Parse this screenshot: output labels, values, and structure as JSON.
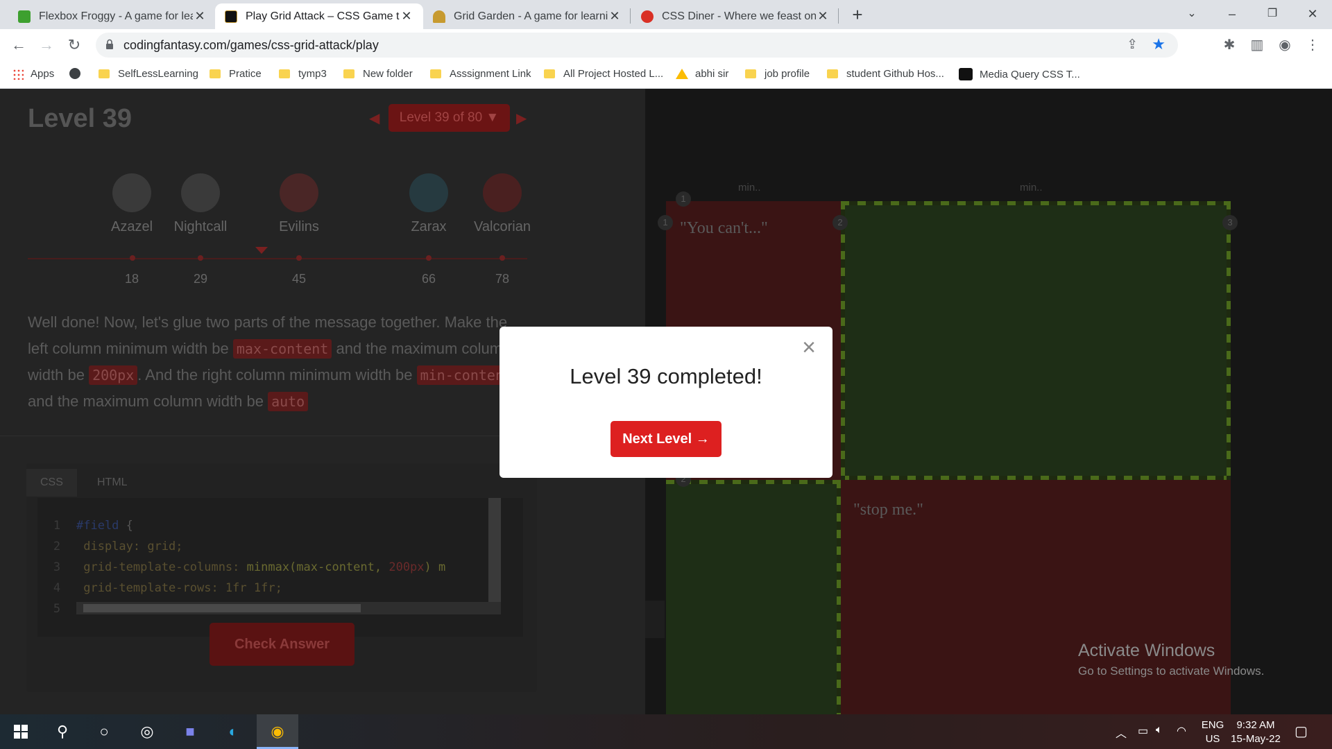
{
  "browser": {
    "tabs": [
      {
        "title": "Flexbox Froggy - A game for lear",
        "favicon_color": "#3da02f"
      },
      {
        "title": "Play Grid Attack – CSS Game to l",
        "favicon_color": "#111111"
      },
      {
        "title": "Grid Garden - A game for learnin",
        "favicon_color": "#c79a2f"
      },
      {
        "title": "CSS Diner - Where we feast on C",
        "favicon_color": "#d93025"
      }
    ],
    "url": "codingfantasy.com/games/css-grid-attack/play",
    "bookmarks": [
      {
        "label": "Apps",
        "icon": "apps-grid-icon"
      },
      {
        "label": "",
        "icon": "globe-icon"
      },
      {
        "label": "SelfLessLearning",
        "icon": "folder-icon"
      },
      {
        "label": "Pratice",
        "icon": "folder-icon"
      },
      {
        "label": "tymp3",
        "icon": "folder-icon"
      },
      {
        "label": "New folder",
        "icon": "folder-icon"
      },
      {
        "label": "Asssignment Link",
        "icon": "folder-icon"
      },
      {
        "label": "All Project Hosted L...",
        "icon": "folder-icon"
      },
      {
        "label": "abhi sir",
        "icon": "google-drive-icon"
      },
      {
        "label": "job profile",
        "icon": "folder-icon"
      },
      {
        "label": "student Github Hos...",
        "icon": "folder-icon"
      },
      {
        "label": "Media Query CSS T...",
        "icon": "site-icon"
      }
    ]
  },
  "game": {
    "level_title": "Level 39",
    "level_selector": "Level 39 of 80 ▼",
    "enemies": [
      {
        "name": "Azazel",
        "level": "18"
      },
      {
        "name": "Nightcall",
        "level": "29"
      },
      {
        "name": "Evilins",
        "level": "45"
      },
      {
        "name": "Zarax",
        "level": "66"
      },
      {
        "name": "Valcorian",
        "level": "78"
      }
    ],
    "instructions": {
      "p1": "Well done! Now, let's glue two parts of the message together. Make the left column minimum width be ",
      "c1": "max-content",
      "p2": " and the maximum column width be ",
      "c2": "200px",
      "p3": ". And the right column minimum width be ",
      "c3": "min-content",
      "p4": " and the maximum column width be ",
      "c4": "auto"
    },
    "editor_tabs": [
      "CSS",
      "HTML"
    ],
    "code": {
      "line_numbers": [
        "1",
        "2",
        "3",
        "4",
        "5"
      ],
      "l1_selector": "#field",
      "l1_brace": " {",
      "l2": "  display: grid;",
      "l3_prop": "  grid-template-columns: ",
      "l3_fn": "minmax(max-content, ",
      "l3_num": "200px",
      "l3_rest": ") m",
      "l4": "  grid-template-rows: 1fr 1fr;"
    },
    "check_button": "Check Answer",
    "field": {
      "column_labels": [
        "min..",
        "min.."
      ],
      "line_numbers": [
        "1",
        "1",
        "2",
        "3",
        "2"
      ],
      "quote_top": "\"You can't...\"",
      "quote_bottom": "\"stop me.\""
    }
  },
  "modal": {
    "title": "Level 39 completed!",
    "button": "Next Level →",
    "close_symbol": "×"
  },
  "watermark": {
    "title": "Activate Windows",
    "subtitle": "Go to Settings to activate Windows."
  },
  "taskbar": {
    "lang_top": "ENG",
    "lang_bottom": "US",
    "time": "9:32 AM",
    "date": "15-May-22"
  }
}
